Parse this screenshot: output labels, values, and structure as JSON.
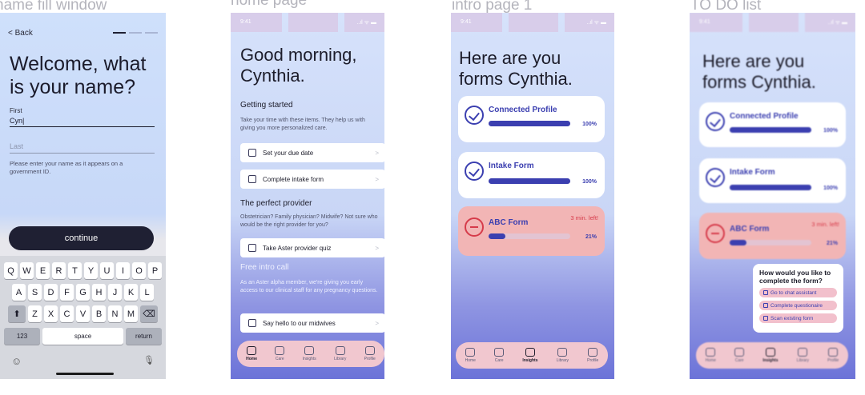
{
  "frames": {
    "name_fill": "name fill window",
    "home": "home page",
    "intro": "intro page 1",
    "todo": "TO DO list"
  },
  "name_fill": {
    "back": "< Back",
    "title": "Welcome, what is your name?",
    "first_label": "First",
    "first_value": "Cyn|",
    "last_placeholder": "Last",
    "hint": "Please enter your name as it appears on a government ID.",
    "continue": "continue",
    "keyboard": {
      "row1": [
        "Q",
        "W",
        "E",
        "R",
        "T",
        "Y",
        "U",
        "I",
        "O",
        "P"
      ],
      "row2": [
        "A",
        "S",
        "D",
        "F",
        "G",
        "H",
        "J",
        "K",
        "L"
      ],
      "row3": [
        "Z",
        "X",
        "C",
        "V",
        "B",
        "N",
        "M"
      ],
      "shift": "⬆",
      "backspace": "⌫",
      "numbers": "123",
      "space": "space",
      "return": "return",
      "emoji": "☺",
      "mic": "🎙"
    }
  },
  "status": {
    "time": "9:41",
    "icons": "..ıl ᯤ ▬"
  },
  "home": {
    "title": "Good morning, Cynthia.",
    "getting_started": "Getting started",
    "getting_started_text": "Take your time with these items. They help us with giving you more personalized care.",
    "item_due_date": "Set your due date",
    "item_intake": "Complete intake form",
    "perfect_provider": "The perfect provider",
    "perfect_provider_text": "Obstetrician? Family physician? Midwife? Not sure who would be the right provider for you?",
    "item_quiz": "Take Aster provider quiz",
    "free_intro": "Free intro call",
    "free_intro_text": "As an Aster alpha member, we're giving you early access to our clinical staff for any pregnancy questions.",
    "item_midwives": "Say hello to our midwives",
    "chevron": ">"
  },
  "tabs": [
    "Home",
    "Care",
    "Insights",
    "Library",
    "Profile"
  ],
  "intro": {
    "title": "Here are you forms Cynthia.",
    "forms": [
      {
        "name": "Connected Profile",
        "percent_label": "100%",
        "progress": 1.0
      },
      {
        "name": "Intake Form",
        "percent_label": "100%",
        "progress": 1.0
      },
      {
        "name": "ABC Form",
        "percent_label": "21%",
        "progress": 0.21,
        "time_left": "3 min. left!"
      }
    ]
  },
  "todo": {
    "title": "Here are you forms Cynthia.",
    "popup_question": "How would you like to complete the form?",
    "options": [
      "Go to chat assistant",
      "Complete questionaire",
      "Scan existing form"
    ]
  },
  "colors": {
    "accent": "#3b3fb0",
    "alert": "#d63b4a",
    "tabbar": "#f1c7cf",
    "dark": "#1f2033"
  }
}
